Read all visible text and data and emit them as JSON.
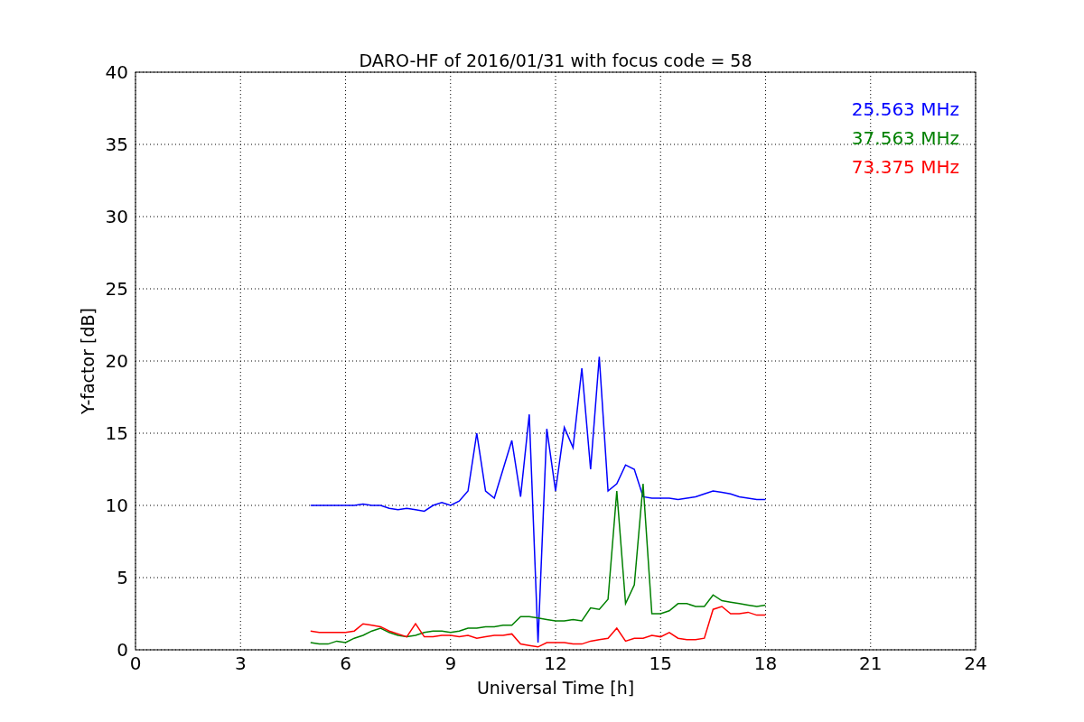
{
  "figure": {
    "chart_data": {
      "type": "line",
      "title": "DARO-HF of 2016/01/31 with focus code = 58",
      "xlabel": "Universal Time [h]",
      "ylabel": "Y-factor [dB]",
      "x": [
        5,
        5.25,
        5.5,
        5.75,
        6,
        6.25,
        6.5,
        6.75,
        7,
        7.25,
        7.5,
        7.75,
        8,
        8.25,
        8.5,
        8.75,
        9,
        9.25,
        9.5,
        9.75,
        10,
        10.25,
        10.5,
        10.75,
        11,
        11.25,
        11.5,
        11.75,
        12,
        12.25,
        12.5,
        12.75,
        13,
        13.25,
        13.5,
        13.75,
        14,
        14.25,
        14.5,
        14.75,
        15,
        15.25,
        15.5,
        15.75,
        16,
        16.25,
        16.5,
        16.75,
        17,
        17.25,
        17.5,
        17.75,
        18
      ],
      "series": [
        {
          "name": "25.563 MHz",
          "color": "#0000ff",
          "values": [
            10,
            10,
            10,
            10,
            10,
            10,
            10.1,
            10,
            10,
            9.8,
            9.7,
            9.8,
            9.7,
            9.6,
            10,
            10.2,
            10,
            10.3,
            11,
            15,
            11,
            10.5,
            12.5,
            14.5,
            10.6,
            16.3,
            0.5,
            15.3,
            11,
            15.4,
            14,
            19.5,
            12.5,
            20.3,
            11,
            11.5,
            12.8,
            12.5,
            10.6,
            10.5,
            10.5,
            10.5,
            10.4,
            10.5,
            10.6,
            10.8,
            11,
            10.9,
            10.8,
            10.6,
            10.5,
            10.4,
            10.4
          ]
        },
        {
          "name": "37.563 MHz",
          "color": "#008000",
          "values": [
            0.5,
            0.4,
            0.4,
            0.6,
            0.5,
            0.8,
            1,
            1.3,
            1.5,
            1.2,
            1,
            0.9,
            1,
            1.2,
            1.3,
            1.3,
            1.2,
            1.3,
            1.5,
            1.5,
            1.6,
            1.6,
            1.7,
            1.7,
            2.3,
            2.3,
            2.2,
            2.1,
            2,
            2,
            2.1,
            2,
            2.9,
            2.8,
            3.5,
            11,
            3.2,
            4.5,
            11.5,
            2.5,
            2.5,
            2.7,
            3.2,
            3.2,
            3,
            3,
            3.8,
            3.4,
            3.3,
            3.2,
            3.1,
            3,
            3.1
          ]
        },
        {
          "name": "73.375 MHz",
          "color": "#ff0000",
          "values": [
            1.3,
            1.2,
            1.2,
            1.2,
            1.2,
            1.3,
            1.8,
            1.7,
            1.6,
            1.3,
            1.1,
            0.9,
            1.8,
            0.9,
            0.9,
            1,
            1,
            0.9,
            1,
            0.8,
            0.9,
            1,
            1,
            1.1,
            0.4,
            0.3,
            0.2,
            0.5,
            0.5,
            0.5,
            0.4,
            0.4,
            0.6,
            0.7,
            0.8,
            1.5,
            0.6,
            0.8,
            0.8,
            1,
            0.9,
            1.2,
            0.8,
            0.7,
            0.7,
            0.8,
            2.8,
            3,
            2.5,
            2.5,
            2.6,
            2.4,
            2.4
          ]
        }
      ],
      "grid": true,
      "xlim": [
        0,
        24
      ],
      "ylim": [
        0,
        40
      ],
      "xticks": [
        0,
        3,
        6,
        9,
        12,
        15,
        18,
        21,
        24
      ],
      "yticks": [
        0,
        5,
        10,
        15,
        20,
        25,
        30,
        35,
        40
      ]
    }
  }
}
